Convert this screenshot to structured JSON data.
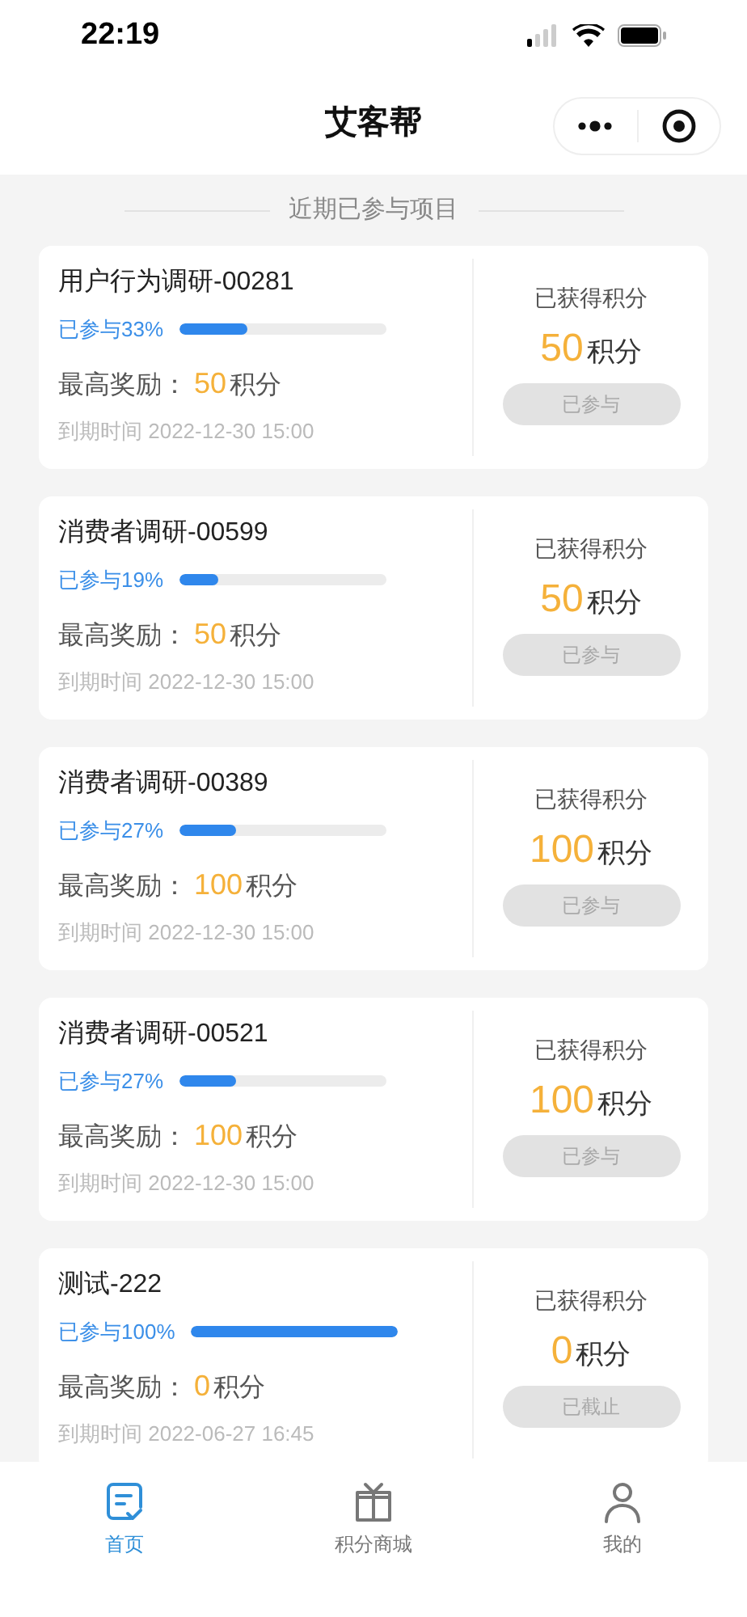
{
  "status_bar": {
    "time": "22:19"
  },
  "nav": {
    "title": "艾客帮"
  },
  "section_title": "近期已参与项目",
  "projects": [
    {
      "title": "用户行为调研-00281",
      "progress": "已参与33%",
      "level": 0.33,
      "reward_label": "最高奖励：",
      "reward": "50",
      "reward_unit": "积分",
      "due": "到期时间 2022-12-30 15:00",
      "earned_label": "已获得积分",
      "earned": "50",
      "earned_unit": "积分",
      "status": "已参与"
    },
    {
      "title": "消费者调研-00599",
      "progress": "已参与19%",
      "level": 0.19,
      "reward_label": "最高奖励：",
      "reward": "50",
      "reward_unit": "积分",
      "due": "到期时间 2022-12-30 15:00",
      "earned_label": "已获得积分",
      "earned": "50",
      "earned_unit": "积分",
      "status": "已参与"
    },
    {
      "title": "消费者调研-00389",
      "progress": "已参与27%",
      "level": 0.27,
      "reward_label": "最高奖励：",
      "reward": "100",
      "reward_unit": "积分",
      "due": "到期时间 2022-12-30 15:00",
      "earned_label": "已获得积分",
      "earned": "100",
      "earned_unit": "积分",
      "status": "已参与"
    },
    {
      "title": "消费者调研-00521",
      "progress": "已参与27%",
      "level": 0.27,
      "reward_label": "最高奖励：",
      "reward": "100",
      "reward_unit": "积分",
      "due": "到期时间 2022-12-30 15:00",
      "earned_label": "已获得积分",
      "earned": "100",
      "earned_unit": "积分",
      "status": "已参与"
    },
    {
      "title": "测试-222",
      "progress": "已参与100%",
      "level": 1,
      "reward_label": "最高奖励：",
      "reward": "0",
      "reward_unit": "积分",
      "due": "到期时间 2022-06-27 16:45",
      "earned_label": "已获得积分",
      "earned": "0",
      "earned_unit": "积分",
      "status": "已截止"
    }
  ],
  "tabs": [
    {
      "label": "首页",
      "kind": "home",
      "selected": true
    },
    {
      "label": "积分商城",
      "kind": "gift",
      "selected": false
    },
    {
      "label": "我的",
      "kind": "user",
      "selected": false
    }
  ]
}
